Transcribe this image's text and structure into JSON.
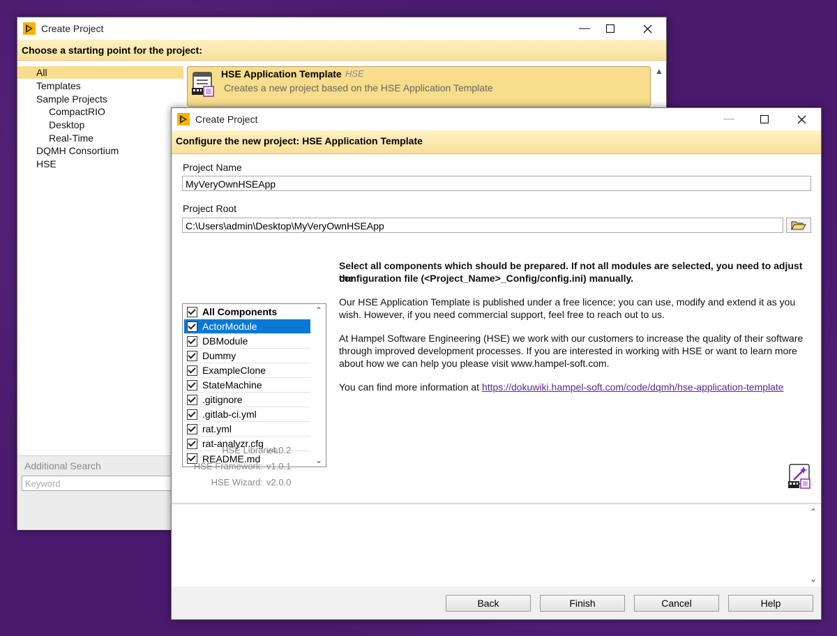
{
  "back_window": {
    "title": "Create Project",
    "banner": "Choose a starting point for the project:",
    "categories": [
      {
        "label": "All",
        "selected": true
      },
      {
        "label": "Templates"
      },
      {
        "label": "Sample Projects"
      },
      {
        "label": "CompactRIO"
      },
      {
        "label": "Desktop"
      },
      {
        "label": "Real-Time"
      },
      {
        "label": "DQMH Consortium"
      },
      {
        "label": "HSE"
      }
    ],
    "template": {
      "name": "HSE Application Template",
      "tag": "HSE",
      "description": "Creates a new project based on the HSE Application Template"
    },
    "additional_search": {
      "label": "Additional Search",
      "placeholder": "Keyword"
    }
  },
  "front_window": {
    "title": "Create Project",
    "banner": "Configure the new project: HSE Application Template",
    "project_name": {
      "label": "Project Name",
      "value": "MyVeryOwnHSEApp"
    },
    "project_root": {
      "label": "Project Root",
      "value": "C:\\Users\\admin\\Desktop\\MyVeryOwnHSEApp"
    },
    "components": [
      {
        "label": "All Components",
        "checked": true
      },
      {
        "label": "ActorModule",
        "checked": true,
        "highlighted": true
      },
      {
        "label": "DBModule",
        "checked": true
      },
      {
        "label": "Dummy",
        "checked": true
      },
      {
        "label": "ExampleClone",
        "checked": true
      },
      {
        "label": "StateMachine",
        "checked": true
      },
      {
        "label": ".gitignore",
        "checked": true
      },
      {
        "label": ".gitlab-ci.yml",
        "checked": true
      },
      {
        "label": "rat.yml",
        "checked": true
      },
      {
        "label": "rat-analyzr.cfg",
        "checked": true
      },
      {
        "label": "README.md",
        "checked": true
      }
    ],
    "info": {
      "p1_line1": "Select all components which should be prepared. If not all modules are selected, you need to adjust the",
      "p1_line2": "configuration file (<Project_Name>_Config/config.ini) manually.",
      "p2_line1": "Our HSE Application Template is published under a free licence; you can use, modify and extend it as you",
      "p2_line2": "wish. However, if you need commercial support, feel free to reach out to us.",
      "p3_line1": "At Hampel Software Engineering (HSE) we work with our customers to increase the quality of their software",
      "p3_line2": "through improved development processes. If you are interested in working with HSE or want to learn more",
      "p3_line3": "about how we can help you please visit www.hampel-soft.com.",
      "p4_prefix": "You can find more information at ",
      "p4_link": "https://dokuwiki.hampel-soft.com/code/dqmh/hse-application-template"
    },
    "versions": [
      {
        "label": "HSE Libraries:",
        "value": "v4.0.2"
      },
      {
        "label": "HSE Framework:",
        "value": "v1.0.1"
      },
      {
        "label": "HSE Wizard:",
        "value": "v2.0.0"
      }
    ],
    "buttons": {
      "back": "Back",
      "finish": "Finish",
      "cancel": "Cancel",
      "help": "Help"
    }
  },
  "colors": {
    "banner": "#f7e09a",
    "selection": "#f7dd8c",
    "highlight": "#0a78d7",
    "link": "#5a2a8a",
    "desktop": "#4a1a6e"
  }
}
